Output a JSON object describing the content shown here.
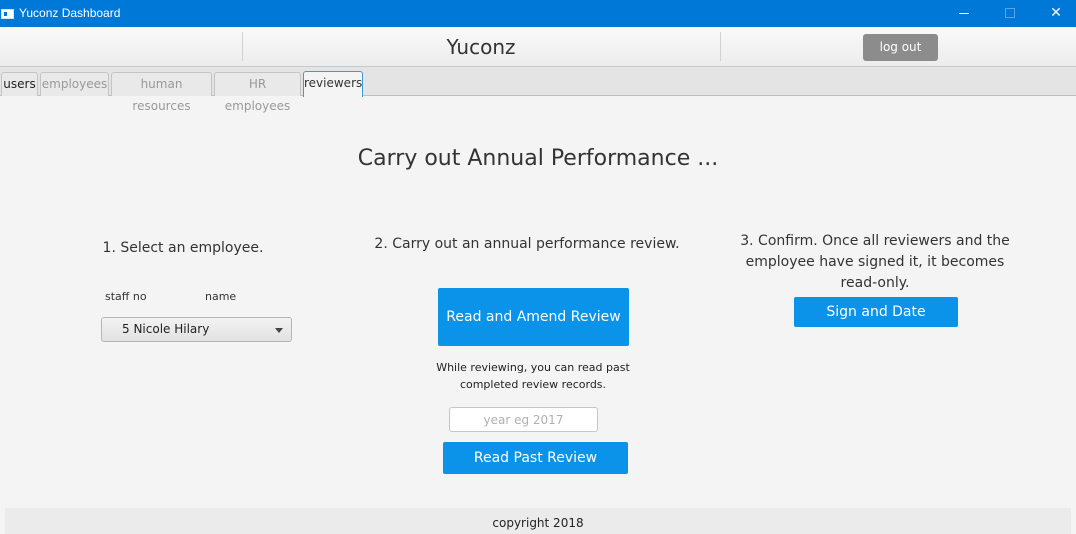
{
  "window": {
    "title": "Yuconz Dashboard",
    "controls": {
      "minimize": "—",
      "maximize": "☐",
      "close": "✕"
    }
  },
  "header": {
    "app_name": "Yuconz",
    "logout_label": "log out"
  },
  "tabs": [
    {
      "label": "users",
      "selected": false
    },
    {
      "label": "employees",
      "selected": false
    },
    {
      "label": "human resources",
      "selected": false
    },
    {
      "label": "HR employees",
      "selected": false
    },
    {
      "label": "reviewers",
      "selected": true
    }
  ],
  "main": {
    "title": "Carry out Annual Performance ...",
    "step1": {
      "title": "1. Select an employee.",
      "col_staff_no": "staff no",
      "col_name": "name",
      "selected_employee": "5  Nicole Hilary"
    },
    "step2": {
      "title": "2. Carry out an annual performance review.",
      "amend_button": "Read and Amend Review",
      "hint_line1": "While reviewing, you can read past",
      "hint_line2": "completed review records.",
      "year_placeholder": "year eg 2017",
      "read_past_button": "Read Past Review"
    },
    "step3": {
      "title_line1": "3. Confirm. Once all reviewers and the",
      "title_line2": "employee have signed it, it becomes",
      "title_line3": "read-only.",
      "sign_button": "Sign and Date"
    }
  },
  "footer": {
    "text": "copyright 2018"
  },
  "colors": {
    "titlebar": "#0078d7",
    "primary_button": "#0a93e9",
    "logout_button": "#8c8c8c",
    "selected_tab_border": "#3a9bd9"
  }
}
